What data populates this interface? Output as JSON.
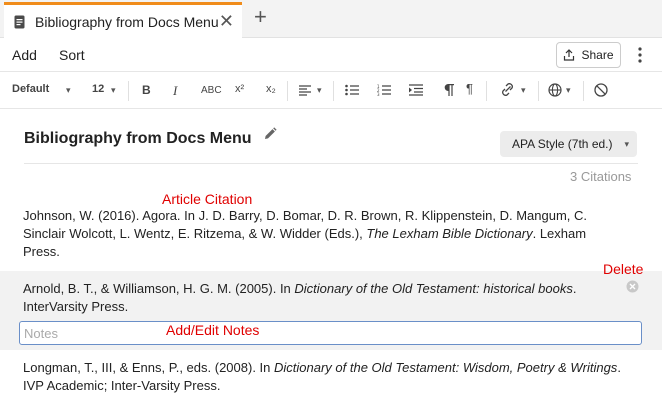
{
  "tab": {
    "title": "Bibliography from Docs Menu"
  },
  "menu": {
    "add_label": "Add",
    "sort_label": "Sort",
    "share_label": "Share"
  },
  "toolbar": {
    "style": "Default",
    "font_size": "12",
    "strikethrough": "ABC",
    "superscript": "x²",
    "subscript": "x₂"
  },
  "document": {
    "title": "Bibliography from Docs Menu",
    "citation_style": "APA Style (7th ed.)",
    "citation_count": "3 Citations"
  },
  "annotations": {
    "article_citation": "Article Citation",
    "delete": "Delete",
    "add_edit_notes": "Add/Edit Notes"
  },
  "citations": [
    {
      "before": "Johnson, W. (2016). Agora. In J. D. Barry, D. Bomar, D. R. Brown, R. Klippenstein, D. Mangum, C. Sinclair Wolcott, L. Wentz, E. Ritzema, & W. Widder (Eds.), ",
      "italic": "The Lexham Bible Dictionary",
      "after": ". Lexham Press."
    },
    {
      "before": "Arnold, B. T., & Williamson, H. G. M. (2005). In ",
      "italic": "Dictionary of the Old Testament: historical books",
      "after": ". InterVarsity Press."
    },
    {
      "before": "Longman, T., III, & Enns, P., eds. (2008). In ",
      "italic": "Dictionary of the Old Testament: Wisdom, Poetry & Writings",
      "after": ". IVP Academic; Inter-Varsity Press."
    }
  ],
  "notes": {
    "placeholder": "Notes",
    "value": ""
  },
  "colors": {
    "accent": "#f08c1b",
    "annotation": "#e00000",
    "focus": "#6a8fc8"
  }
}
